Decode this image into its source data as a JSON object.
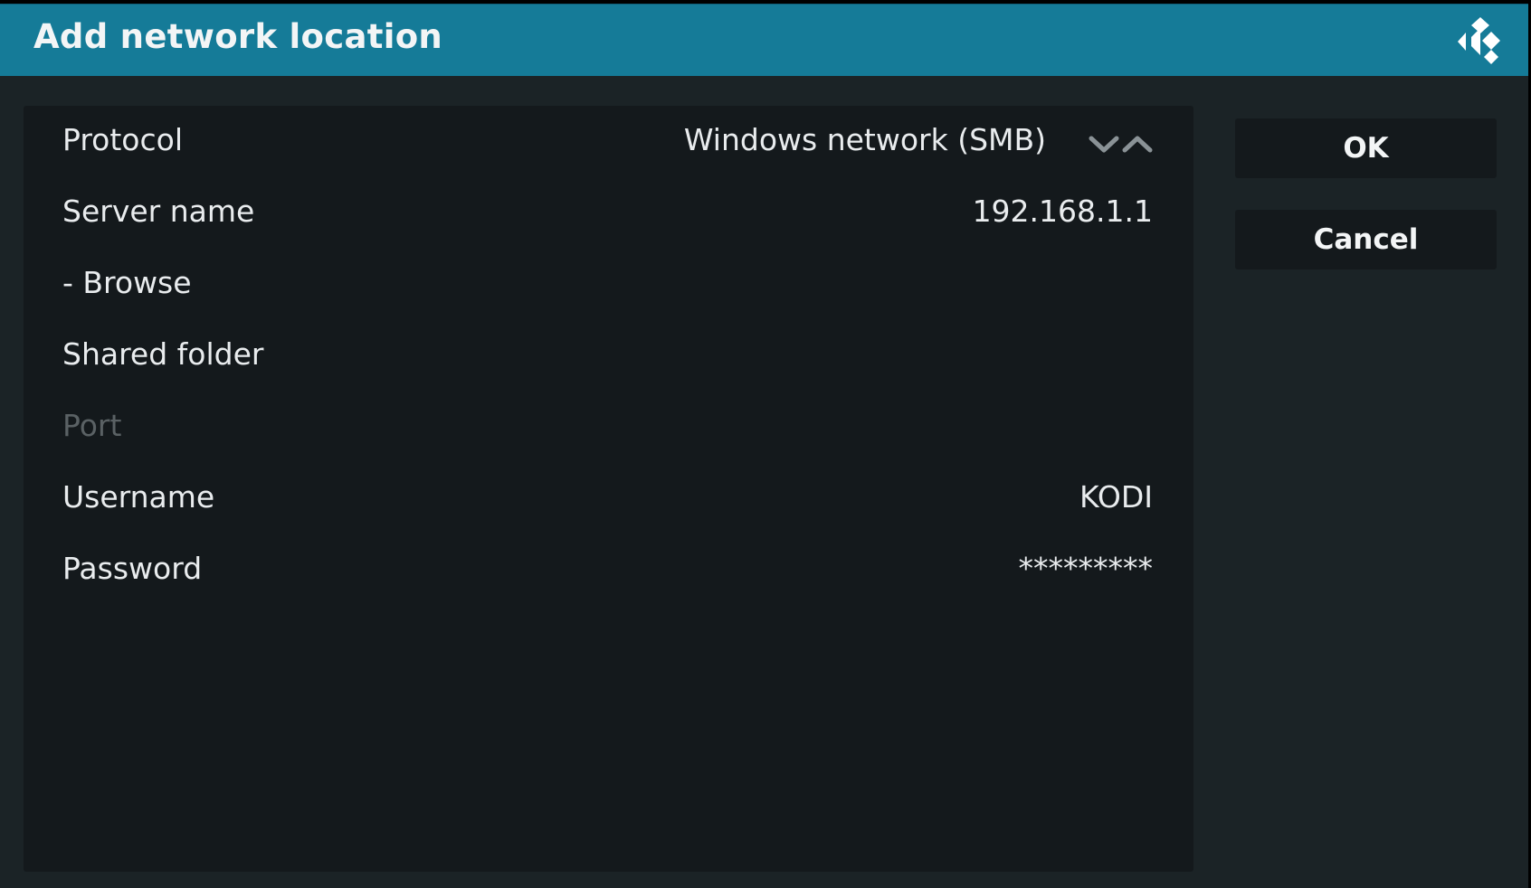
{
  "dialog": {
    "title": "Add network location"
  },
  "form": {
    "rows": [
      {
        "label": "Protocol",
        "value": "Windows network (SMB)"
      },
      {
        "label": "Server name",
        "value": "192.168.1.1"
      },
      {
        "label": "- Browse",
        "value": ""
      },
      {
        "label": "Shared folder",
        "value": ""
      },
      {
        "label": "Port",
        "value": ""
      },
      {
        "label": "Username",
        "value": "KODI"
      },
      {
        "label": "Password",
        "value": "*********"
      }
    ]
  },
  "buttons": {
    "ok_label": "OK",
    "cancel_label": "Cancel"
  },
  "icons": {
    "logo": "kodi-logo-icon",
    "protocol_down": "chevron-down-icon",
    "protocol_up": "chevron-up-icon"
  },
  "colors": {
    "header": "#157b98",
    "background": "#1b2326",
    "panel": "#14191c",
    "text": "#e9ecee",
    "disabled_text": "#5a6164"
  }
}
